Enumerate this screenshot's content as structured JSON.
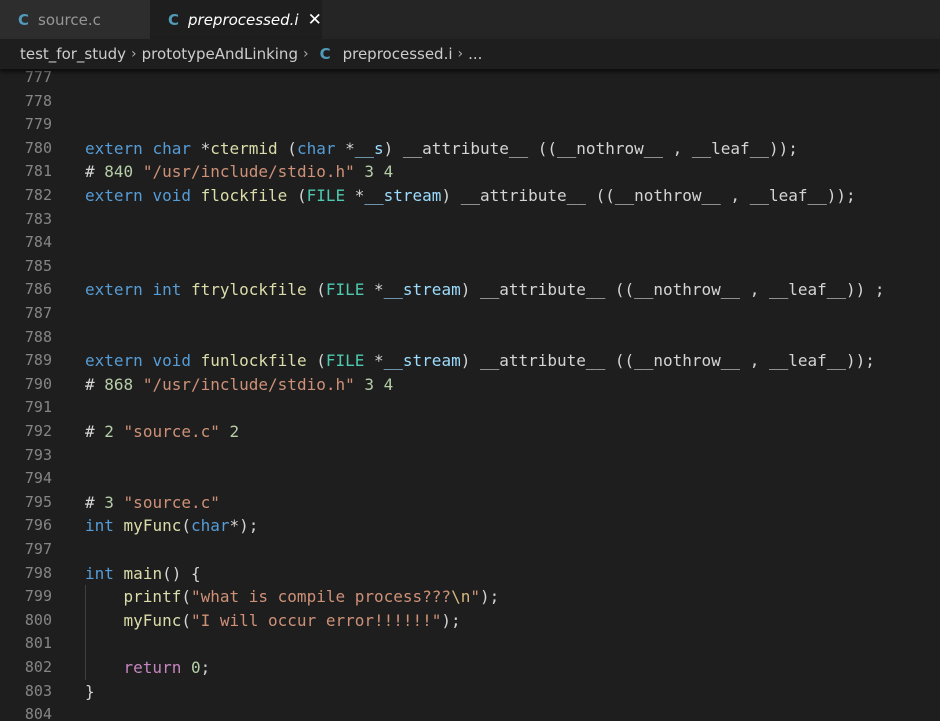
{
  "tabs": [
    {
      "icon": "C",
      "label": "source.c"
    },
    {
      "icon": "C",
      "label": "preprocessed.i",
      "close": "✕"
    }
  ],
  "breadcrumb": {
    "items": [
      "test_for_study",
      "prototypeAndLinking"
    ],
    "file_icon": "C",
    "file": "preprocessed.i",
    "ellipsis": "...",
    "separator": "›"
  },
  "lines": [
    {
      "n": "777",
      "tokens": []
    },
    {
      "n": "778",
      "tokens": []
    },
    {
      "n": "779",
      "tokens": []
    },
    {
      "n": "780",
      "tokens": [
        {
          "t": "extern",
          "c": "kw"
        },
        {
          "t": " "
        },
        {
          "t": "char",
          "c": "kw"
        },
        {
          "t": " *"
        },
        {
          "t": "ctermid",
          "c": "fn"
        },
        {
          "t": " ("
        },
        {
          "t": "char",
          "c": "kw"
        },
        {
          "t": " *"
        },
        {
          "t": "__s",
          "c": "var"
        },
        {
          "t": ") __attribute__ ((__nothrow__ , __leaf__));"
        }
      ]
    },
    {
      "n": "781",
      "tokens": [
        {
          "t": "# "
        },
        {
          "t": "840",
          "c": "num"
        },
        {
          "t": " "
        },
        {
          "t": "\"/usr/include/stdio.h\"",
          "c": "str"
        },
        {
          "t": " "
        },
        {
          "t": "3",
          "c": "num"
        },
        {
          "t": " "
        },
        {
          "t": "4",
          "c": "num"
        }
      ]
    },
    {
      "n": "782",
      "tokens": [
        {
          "t": "extern",
          "c": "kw"
        },
        {
          "t": " "
        },
        {
          "t": "void",
          "c": "kw"
        },
        {
          "t": " "
        },
        {
          "t": "flockfile",
          "c": "fn"
        },
        {
          "t": " ("
        },
        {
          "t": "FILE",
          "c": "ty"
        },
        {
          "t": " *"
        },
        {
          "t": "__stream",
          "c": "var"
        },
        {
          "t": ") __attribute__ ((__nothrow__ , __leaf__));"
        }
      ]
    },
    {
      "n": "783",
      "tokens": []
    },
    {
      "n": "784",
      "tokens": []
    },
    {
      "n": "785",
      "tokens": []
    },
    {
      "n": "786",
      "tokens": [
        {
          "t": "extern",
          "c": "kw"
        },
        {
          "t": " "
        },
        {
          "t": "int",
          "c": "kw"
        },
        {
          "t": " "
        },
        {
          "t": "ftrylockfile",
          "c": "fn"
        },
        {
          "t": " ("
        },
        {
          "t": "FILE",
          "c": "ty"
        },
        {
          "t": " *"
        },
        {
          "t": "__stream",
          "c": "var"
        },
        {
          "t": ") __attribute__ ((__nothrow__ , __leaf__)) ;"
        }
      ]
    },
    {
      "n": "787",
      "tokens": []
    },
    {
      "n": "788",
      "tokens": []
    },
    {
      "n": "789",
      "tokens": [
        {
          "t": "extern",
          "c": "kw"
        },
        {
          "t": " "
        },
        {
          "t": "void",
          "c": "kw"
        },
        {
          "t": " "
        },
        {
          "t": "funlockfile",
          "c": "fn"
        },
        {
          "t": " ("
        },
        {
          "t": "FILE",
          "c": "ty"
        },
        {
          "t": " *"
        },
        {
          "t": "__stream",
          "c": "var"
        },
        {
          "t": ") __attribute__ ((__nothrow__ , __leaf__));"
        }
      ]
    },
    {
      "n": "790",
      "tokens": [
        {
          "t": "# "
        },
        {
          "t": "868",
          "c": "num"
        },
        {
          "t": " "
        },
        {
          "t": "\"/usr/include/stdio.h\"",
          "c": "str"
        },
        {
          "t": " "
        },
        {
          "t": "3",
          "c": "num"
        },
        {
          "t": " "
        },
        {
          "t": "4",
          "c": "num"
        }
      ]
    },
    {
      "n": "791",
      "tokens": []
    },
    {
      "n": "792",
      "tokens": [
        {
          "t": "# "
        },
        {
          "t": "2",
          "c": "num"
        },
        {
          "t": " "
        },
        {
          "t": "\"source.c\"",
          "c": "str"
        },
        {
          "t": " "
        },
        {
          "t": "2",
          "c": "num"
        }
      ]
    },
    {
      "n": "793",
      "tokens": []
    },
    {
      "n": "794",
      "tokens": []
    },
    {
      "n": "795",
      "tokens": [
        {
          "t": "# "
        },
        {
          "t": "3",
          "c": "num"
        },
        {
          "t": " "
        },
        {
          "t": "\"source.c\"",
          "c": "str"
        }
      ]
    },
    {
      "n": "796",
      "tokens": [
        {
          "t": "int",
          "c": "kw"
        },
        {
          "t": " "
        },
        {
          "t": "myFunc",
          "c": "fn"
        },
        {
          "t": "("
        },
        {
          "t": "char",
          "c": "kw"
        },
        {
          "t": "*);"
        }
      ]
    },
    {
      "n": "797",
      "tokens": []
    },
    {
      "n": "798",
      "tokens": [
        {
          "t": "int",
          "c": "kw"
        },
        {
          "t": " "
        },
        {
          "t": "main",
          "c": "fn"
        },
        {
          "t": "() {"
        }
      ]
    },
    {
      "n": "799",
      "tokens": [
        {
          "t": "    "
        },
        {
          "t": "printf",
          "c": "fn"
        },
        {
          "t": "("
        },
        {
          "t": "\"what is compile process???",
          "c": "str"
        },
        {
          "t": "\\n",
          "c": "esc"
        },
        {
          "t": "\"",
          "c": "str"
        },
        {
          "t": ");"
        }
      ]
    },
    {
      "n": "800",
      "tokens": [
        {
          "t": "    "
        },
        {
          "t": "myFunc",
          "c": "fn"
        },
        {
          "t": "("
        },
        {
          "t": "\"I will occur error!!!!!!\"",
          "c": "str"
        },
        {
          "t": ");"
        }
      ]
    },
    {
      "n": "801",
      "tokens": []
    },
    {
      "n": "802",
      "tokens": [
        {
          "t": "    "
        },
        {
          "t": "return",
          "c": "ctrl"
        },
        {
          "t": " "
        },
        {
          "t": "0",
          "c": "num"
        },
        {
          "t": ";"
        }
      ]
    },
    {
      "n": "803",
      "tokens": [
        {
          "t": "}"
        }
      ]
    },
    {
      "n": "804",
      "tokens": []
    }
  ]
}
